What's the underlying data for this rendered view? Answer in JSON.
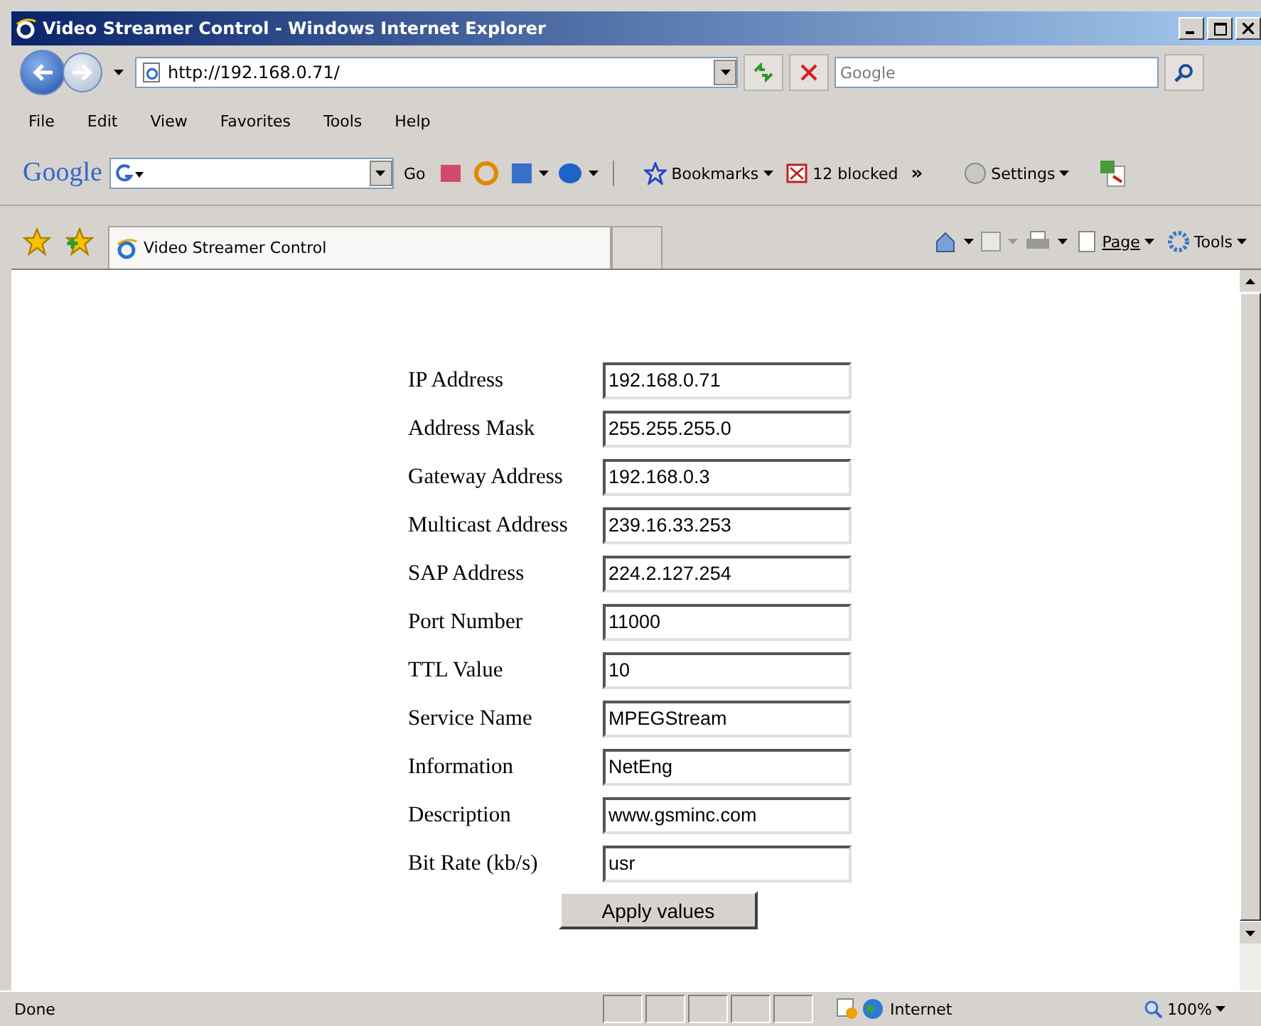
{
  "window": {
    "title": "Video Streamer Control - Windows Internet Explorer"
  },
  "address_bar": {
    "value": "http://192.168.0.71/"
  },
  "search": {
    "placeholder": "Google"
  },
  "menu": [
    "File",
    "Edit",
    "View",
    "Favorites",
    "Tools",
    "Help"
  ],
  "google_toolbar": {
    "logo": "Google",
    "go": "Go",
    "bookmarks": "Bookmarks",
    "blocked": "12 blocked",
    "more": "»",
    "settings": "Settings"
  },
  "tabs": [
    {
      "title": "Video Streamer Control",
      "selected": true
    }
  ],
  "command_bar": {
    "page": "Page",
    "tools": "Tools"
  },
  "form": {
    "fields": [
      {
        "label": "IP Address",
        "value": "192.168.0.71"
      },
      {
        "label": "Address Mask",
        "value": "255.255.255.0"
      },
      {
        "label": "Gateway Address",
        "value": "192.168.0.3"
      },
      {
        "label": "Multicast Address",
        "value": "239.16.33.253"
      },
      {
        "label": "SAP Address",
        "value": "224.2.127.254"
      },
      {
        "label": "Port Number",
        "value": "11000"
      },
      {
        "label": "TTL Value",
        "value": "10"
      },
      {
        "label": "Service Name",
        "value": "MPEGStream"
      },
      {
        "label": "Information",
        "value": "NetEng"
      },
      {
        "label": "Description",
        "value": "www.gsminc.com"
      },
      {
        "label": "Bit Rate (kb/s)",
        "value": "usr"
      }
    ],
    "button": "Apply values"
  },
  "status_bar": {
    "text": "Done",
    "zone": "Internet",
    "zoom": "100%"
  }
}
